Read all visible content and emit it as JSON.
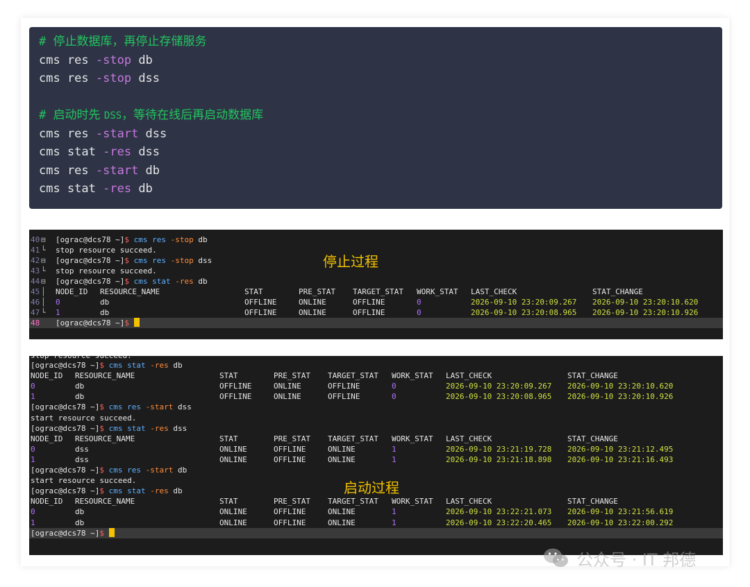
{
  "code_block": {
    "lines": [
      {
        "type": "comment",
        "hash": "#",
        "text": "停止数据库，再停止存储服务"
      },
      {
        "type": "cmd",
        "pre": "cms res ",
        "flag": "-stop",
        "post": " db"
      },
      {
        "type": "cmd",
        "pre": "cms res ",
        "flag": "-stop",
        "post": " dss"
      },
      {
        "type": "blank"
      },
      {
        "type": "comment2",
        "hash": "#",
        "text_a": "启动时先",
        "mono": "DSS",
        "text_b": "，等待在线后再启动数据库"
      },
      {
        "type": "cmd",
        "pre": "cms res ",
        "flag": "-start",
        "post": " dss"
      },
      {
        "type": "cmd",
        "pre": "cms stat ",
        "flag": "-res",
        "post": " dss"
      },
      {
        "type": "cmd",
        "pre": "cms res ",
        "flag": "-start",
        "post": " db"
      },
      {
        "type": "cmd",
        "pre": "cms stat ",
        "flag": "-res",
        "post": " db"
      }
    ]
  },
  "terminal1": {
    "label": "停止过程",
    "prompt": "[ograc@dcs78 ~]",
    "dollar": "$",
    "lines": [
      {
        "n": "40",
        "fold": "⊟",
        "kind": "cmd",
        "cmd": "cms res ",
        "flag": "-stop",
        "arg": " db"
      },
      {
        "n": "41",
        "fold": "└",
        "kind": "text",
        "text": "stop resource succeed."
      },
      {
        "n": "42",
        "fold": "⊟",
        "kind": "cmd",
        "cmd": "cms res ",
        "flag": "-stop",
        "arg": " dss"
      },
      {
        "n": "43",
        "fold": "└",
        "kind": "text",
        "text": "stop resource succeed."
      },
      {
        "n": "44",
        "fold": "⊟",
        "kind": "cmd",
        "cmd": "cms stat ",
        "flag": "-res",
        "arg": " db"
      },
      {
        "n": "45",
        "fold": "│",
        "kind": "header"
      },
      {
        "n": "46",
        "fold": "│",
        "kind": "row",
        "id": "0",
        "name": "db",
        "stat": "OFFLINE",
        "pre": "ONLINE",
        "target": "OFFLINE",
        "work": "0",
        "last": "2026-09-10 23:20:09.267",
        "change": "2026-09-10 23:20:10.620"
      },
      {
        "n": "47",
        "fold": "└",
        "kind": "row",
        "id": "1",
        "name": "db",
        "stat": "OFFLINE",
        "pre": "ONLINE",
        "target": "OFFLINE",
        "work": "0",
        "last": "2026-09-10 23:20:08.965",
        "change": "2026-09-10 23:20:10.926"
      },
      {
        "n": "48",
        "fold": "",
        "kind": "prompt"
      }
    ]
  },
  "terminal2": {
    "label": "启动过程",
    "prompt": "[ograc@dcs78 ~]",
    "dollar": "$",
    "cut_line": "stop resource succeed.",
    "lines": [
      {
        "kind": "cmd",
        "cmd": "cms stat ",
        "flag": "-res",
        "arg": " db"
      },
      {
        "kind": "header"
      },
      {
        "kind": "row",
        "id": "0",
        "name": "db",
        "stat": "OFFLINE",
        "pre": "ONLINE",
        "target": "OFFLINE",
        "work": "0",
        "last": "2026-09-10 23:20:09.267",
        "change": "2026-09-10 23:20:10.620"
      },
      {
        "kind": "row",
        "id": "1",
        "name": "db",
        "stat": "OFFLINE",
        "pre": "ONLINE",
        "target": "OFFLINE",
        "work": "0",
        "last": "2026-09-10 23:20:08.965",
        "change": "2026-09-10 23:20:10.926"
      },
      {
        "kind": "cmd",
        "cmd": "cms res ",
        "flag": "-start",
        "arg": " dss"
      },
      {
        "kind": "text",
        "text": "start resource succeed."
      },
      {
        "kind": "cmd",
        "cmd": "cms stat ",
        "flag": "-res",
        "arg": " dss"
      },
      {
        "kind": "header"
      },
      {
        "kind": "row",
        "id": "0",
        "name": "dss",
        "stat": "ONLINE",
        "pre": "OFFLINE",
        "target": "ONLINE",
        "work": "1",
        "last": "2026-09-10 23:21:19.728",
        "change": "2026-09-10 23:21:12.495"
      },
      {
        "kind": "row",
        "id": "1",
        "name": "dss",
        "stat": "ONLINE",
        "pre": "OFFLINE",
        "target": "ONLINE",
        "work": "1",
        "last": "2026-09-10 23:21:18.898",
        "change": "2026-09-10 23:21:16.493"
      },
      {
        "kind": "cmd",
        "cmd": "cms res ",
        "flag": "-start",
        "arg": " db"
      },
      {
        "kind": "text",
        "text": "start resource succeed."
      },
      {
        "kind": "cmd",
        "cmd": "cms stat ",
        "flag": "-res",
        "arg": " db"
      },
      {
        "kind": "header"
      },
      {
        "kind": "row",
        "id": "0",
        "name": "db",
        "stat": "ONLINE",
        "pre": "OFFLINE",
        "target": "ONLINE",
        "work": "1",
        "last": "2026-09-10 23:22:21.073",
        "change": "2026-09-10 23:21:56.619"
      },
      {
        "kind": "row",
        "id": "1",
        "name": "db",
        "stat": "ONLINE",
        "pre": "OFFLINE",
        "target": "ONLINE",
        "work": "1",
        "last": "2026-09-10 23:22:20.465",
        "change": "2026-09-10 23:22:00.292"
      },
      {
        "kind": "prompt"
      }
    ]
  },
  "table_header": {
    "node_id": "NODE_ID",
    "resource_name": "RESOURCE_NAME",
    "stat": "STAT",
    "pre_stat": "PRE_STAT",
    "target_stat": "TARGET_STAT",
    "work_stat": "WORK_STAT",
    "last_check": "LAST_CHECK",
    "stat_change": "STAT_CHANGE"
  },
  "watermark": {
    "text": "公众号 · IT 邦德"
  },
  "colors": {
    "code_bg": "#2e3446",
    "comment": "#22c55e",
    "flag_purple": "#c678dd",
    "terminal_bg": "#1c1c1c",
    "label_yellow": "#f2c200",
    "date_yellow": "#d0e040",
    "cmd_blue": "#5fafff",
    "flag_orange": "#ff8c3a"
  }
}
